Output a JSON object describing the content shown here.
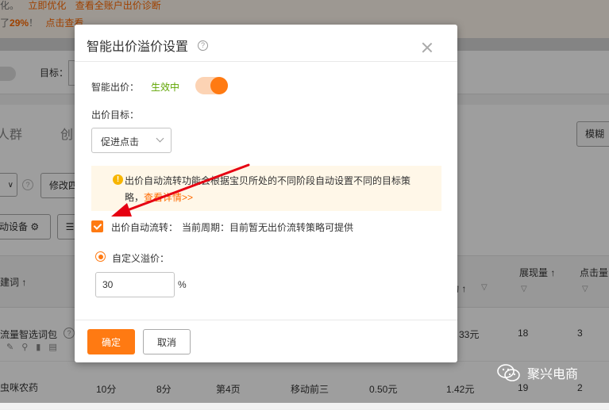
{
  "background": {
    "notice_line1_text": "化。",
    "notice_line1_link1": "立即优化",
    "notice_line1_link2": "查看全账户出价诊断",
    "notice_line2_prefix": "了",
    "notice_line2_percent": "29%",
    "notice_line2_suffix": "！",
    "notice_line2_link": "点击查看",
    "target_label": "目标：",
    "tab_crowd": "人群",
    "tab_creative": "创",
    "fuzzy_button": "模糊",
    "modify_button": "修改四",
    "device_button": "动设备",
    "table_headers": {
      "keyword": "建词 ↑",
      "impressions": "展现量 ↑",
      "clicks": "点击量",
      "mobile": "动 ↑"
    },
    "rows": [
      {
        "keyword": "流量智选词包",
        "c1": "",
        "c2": "",
        "c3": "",
        "c4": "",
        "c5": "",
        "c6": "33元",
        "impressions": "18",
        "clicks": "3"
      },
      {
        "keyword": "虫咪农药",
        "c1": "10分",
        "c2": "8分",
        "c3": "第4页",
        "c4": "移动前三",
        "c5": "0.50元",
        "c6": "1.42元",
        "impressions": "19",
        "clicks": "2"
      }
    ],
    "watermark": "聚兴电商"
  },
  "dialog": {
    "title": "智能出价溢价设置",
    "smart_bid_label": "智能出价：",
    "smart_bid_status": "生效中",
    "smart_bid_enabled": true,
    "bid_target_label": "出价目标：",
    "bid_target_value": "促进点击",
    "notice_text": "出价自动流转功能会根据宝贝所处的不同阶段自动设置不同的目标策略，",
    "notice_link": "查看详情>>",
    "auto_flow_checked": true,
    "auto_flow_label": "出价自动流转：",
    "auto_flow_desc": "当前周期：目前暂无出价流转策略可提供",
    "custom_premium_label": "自定义溢价：",
    "custom_premium_value": "30",
    "percent_sign": "%",
    "confirm_button": "确定",
    "cancel_button": "取消"
  },
  "colors": {
    "accent": "#ff7a12",
    "active_status": "#5fa500",
    "notice_bg": "#fff7e8",
    "arrow": "#e60012"
  }
}
